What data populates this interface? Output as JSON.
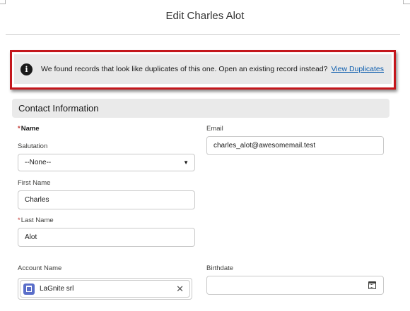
{
  "page": {
    "title": "Edit Charles Alot"
  },
  "duplicate_alert": {
    "message": "We found records that look like duplicates of this one. Open an existing record instead?",
    "link_label": "View Duplicates",
    "icon": "info-icon"
  },
  "section": {
    "title": "Contact Information"
  },
  "form": {
    "name_label": "Name",
    "salutation_label": "Salutation",
    "salutation_value": "--None--",
    "first_name_label": "First Name",
    "first_name_value": "Charles",
    "last_name_label": "Last Name",
    "last_name_value": "Alot",
    "email_label": "Email",
    "email_value": "charles_alot@awesomemail.test",
    "account_label": "Account Name",
    "account_value": "LaGnite srl",
    "birthdate_label": "Birthdate",
    "birthdate_value": "",
    "required_marker": "*"
  },
  "colors": {
    "alert_border": "#c4161c",
    "link": "#0b5cad",
    "required": "#c23934",
    "account_icon": "#5a6ec9"
  }
}
